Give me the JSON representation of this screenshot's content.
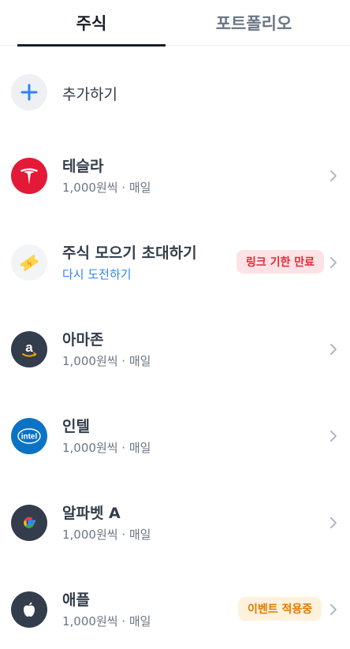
{
  "tabs": [
    {
      "label": "주식",
      "active": true
    },
    {
      "label": "포트폴리오",
      "active": false
    }
  ],
  "add": {
    "label": "추가하기"
  },
  "items": [
    {
      "name": "테슬라",
      "sub": "1,000원씩 · 매일",
      "icon": "tesla-logo-icon"
    },
    {
      "name": "주식 모으기 초대하기",
      "sub": "다시 도전하기",
      "badge": "링크 기한 만료",
      "icon": "ticket-icon"
    },
    {
      "name": "아마존",
      "sub": "1,000원씩 · 매일",
      "icon": "amazon-logo-icon"
    },
    {
      "name": "인텔",
      "sub": "1,000원씩 · 매일",
      "icon": "intel-logo-icon",
      "logo_text": "intel"
    },
    {
      "name": "알파벳 A",
      "sub": "1,000원씩 · 매일",
      "icon": "google-logo-icon",
      "logo_text": "G"
    },
    {
      "name": "애플",
      "sub": "1,000원씩 · 매일",
      "badge": "이벤트 적용중",
      "icon": "apple-logo-icon"
    }
  ],
  "colors": {
    "accent_blue": "#3182f6",
    "tesla_red": "#e31937",
    "badge_red_bg": "#fde3e5",
    "badge_red_text": "#e42939",
    "badge_orange_bg": "#fff1dc",
    "badge_orange_text": "#e07b00",
    "dark_logo_bg": "#333d4b",
    "intel_blue": "#0b73c5"
  }
}
